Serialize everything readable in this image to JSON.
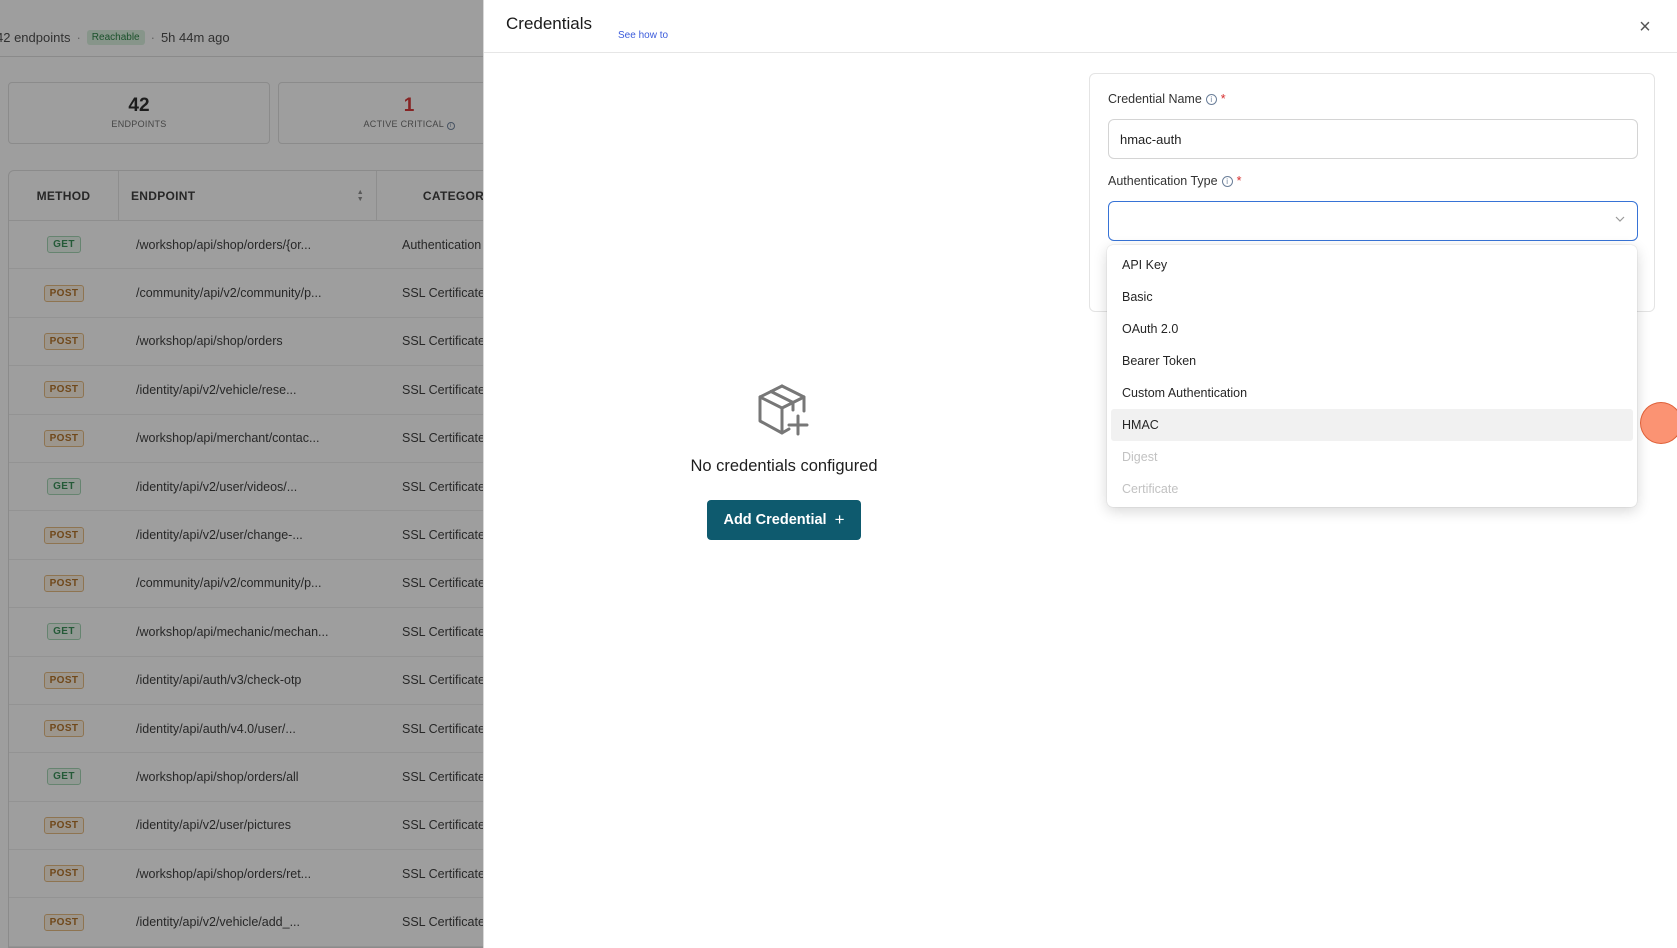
{
  "background": {
    "summary": {
      "endpoints_text": "42 endpoints",
      "status_badge": "Reachable",
      "last_seen": "5h 44m ago"
    },
    "stats": [
      {
        "value": "42",
        "label": "ENDPOINTS"
      },
      {
        "value": "1",
        "label": "ACTIVE CRITICAL"
      }
    ],
    "table": {
      "headers": {
        "method": "METHOD",
        "endpoint": "ENDPOINT",
        "category": "CATEGORY"
      },
      "rows": [
        {
          "method": "GET",
          "endpoint": "/workshop/api/shop/orders/{or...",
          "category": "Authentication"
        },
        {
          "method": "POST",
          "endpoint": "/community/api/v2/community/p...",
          "category": "SSL Certificate"
        },
        {
          "method": "POST",
          "endpoint": "/workshop/api/shop/orders",
          "category": "SSL Certificate"
        },
        {
          "method": "POST",
          "endpoint": "/identity/api/v2/vehicle/rese...",
          "category": "SSL Certificate"
        },
        {
          "method": "POST",
          "endpoint": "/workshop/api/merchant/contac...",
          "category": "SSL Certificate"
        },
        {
          "method": "GET",
          "endpoint": "/identity/api/v2/user/videos/...",
          "category": "SSL Certificate"
        },
        {
          "method": "POST",
          "endpoint": "/identity/api/v2/user/change-...",
          "category": "SSL Certificate"
        },
        {
          "method": "POST",
          "endpoint": "/community/api/v2/community/p...",
          "category": "SSL Certificate"
        },
        {
          "method": "GET",
          "endpoint": "/workshop/api/mechanic/mechan...",
          "category": "SSL Certificate"
        },
        {
          "method": "POST",
          "endpoint": "/identity/api/auth/v3/check-otp",
          "category": "SSL Certificate"
        },
        {
          "method": "POST",
          "endpoint": "/identity/api/auth/v4.0/user/...",
          "category": "SSL Certificate"
        },
        {
          "method": "GET",
          "endpoint": "/workshop/api/shop/orders/all",
          "category": "SSL Certificate"
        },
        {
          "method": "POST",
          "endpoint": "/identity/api/v2/user/pictures",
          "category": "SSL Certificate"
        },
        {
          "method": "POST",
          "endpoint": "/workshop/api/shop/orders/ret...",
          "category": "SSL Certificate"
        },
        {
          "method": "POST",
          "endpoint": "/identity/api/v2/vehicle/add_...",
          "category": "SSL Certificate"
        }
      ]
    }
  },
  "drawer": {
    "title": "Credentials",
    "see_how": "See how to",
    "close_icon": "×",
    "empty_state": {
      "icon": "box-plus-icon",
      "message": "No credentials configured",
      "add_button": "Add Credential",
      "add_icon": "+"
    },
    "form": {
      "name_label": "Credential Name",
      "name_value": "hmac-auth",
      "auth_label": "Authentication Type",
      "auth_value": "",
      "required_mark": "*",
      "info_icon": "i"
    },
    "auth_options": [
      {
        "label": "API Key",
        "disabled": false
      },
      {
        "label": "Basic",
        "disabled": false
      },
      {
        "label": "OAuth 2.0",
        "disabled": false
      },
      {
        "label": "Bearer Token",
        "disabled": false
      },
      {
        "label": "Custom Authentication",
        "disabled": false
      },
      {
        "label": "HMAC",
        "disabled": false,
        "hovered": true
      },
      {
        "label": "Digest",
        "disabled": true
      },
      {
        "label": "Certificate",
        "disabled": true
      }
    ]
  },
  "colors": {
    "primary_button": "#0e5a6e",
    "focus_border": "#3773d6",
    "required": "#d62d2d",
    "click_marker": "#fa805a"
  }
}
